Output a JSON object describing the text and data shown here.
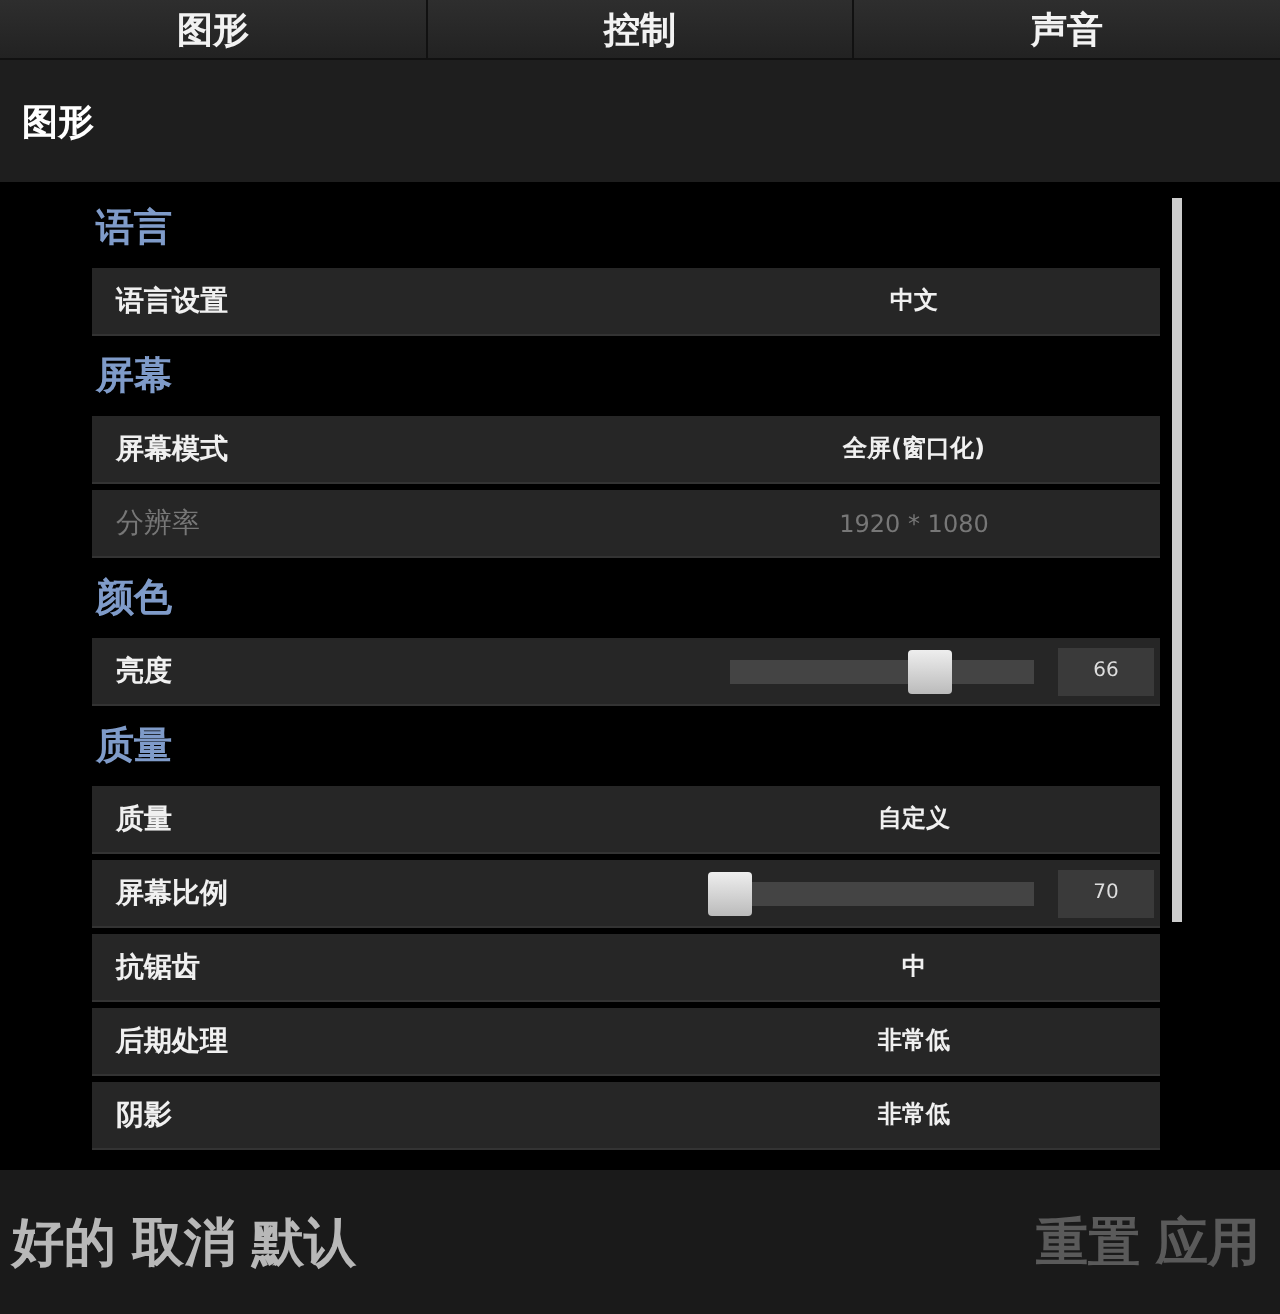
{
  "tabs": [
    {
      "label": "图形"
    },
    {
      "label": "控制"
    },
    {
      "label": "声音"
    }
  ],
  "page_title": "图形",
  "sections": [
    {
      "title": "语言",
      "rows": [
        {
          "kind": "choice",
          "label": "语言设置",
          "value": "中文",
          "disabled": false
        }
      ]
    },
    {
      "title": "屏幕",
      "rows": [
        {
          "kind": "choice",
          "label": "屏幕模式",
          "value": "全屏(窗口化)",
          "disabled": false
        },
        {
          "kind": "choice",
          "label": "分辨率",
          "value": "1920 * 1080",
          "disabled": true
        }
      ]
    },
    {
      "title": "颜色",
      "rows": [
        {
          "kind": "slider",
          "label": "亮度",
          "level": 0.66,
          "value": "66",
          "disabled": false
        }
      ]
    },
    {
      "title": "质量",
      "rows": [
        {
          "kind": "choice",
          "label": "质量",
          "value": "自定义",
          "disabled": false
        },
        {
          "kind": "slider",
          "label": "屏幕比例",
          "level": 0.0,
          "value": "70",
          "disabled": false
        },
        {
          "kind": "choice",
          "label": "抗锯齿",
          "value": "中",
          "disabled": false
        },
        {
          "kind": "choice",
          "label": "后期处理",
          "value": "非常低",
          "disabled": false
        },
        {
          "kind": "choice",
          "label": "阴影",
          "value": "非常低",
          "disabled": false
        }
      ]
    }
  ],
  "footer_left": [
    {
      "label": "好的",
      "disabled": false
    },
    {
      "label": "取消",
      "disabled": false
    },
    {
      "label": "默认",
      "disabled": false
    }
  ],
  "footer_right": [
    {
      "label": "重置",
      "disabled": true
    },
    {
      "label": "应用",
      "disabled": true
    }
  ]
}
